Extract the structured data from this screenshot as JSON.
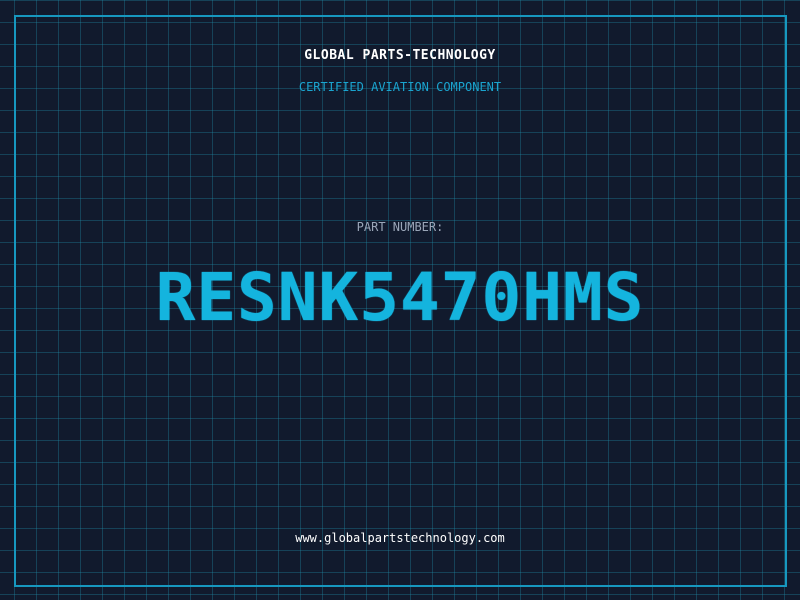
{
  "header": {
    "company": "GLOBAL PARTS-TECHNOLOGY",
    "tagline": "CERTIFIED AVIATION COMPONENT"
  },
  "part": {
    "label": "PART NUMBER:",
    "number": "RESNK5470HMS"
  },
  "footer": {
    "website": "www.globalpartstechnology.com"
  },
  "colors": {
    "background": "#111a2d",
    "accent": "#14b4de",
    "grid": "#208caa"
  }
}
